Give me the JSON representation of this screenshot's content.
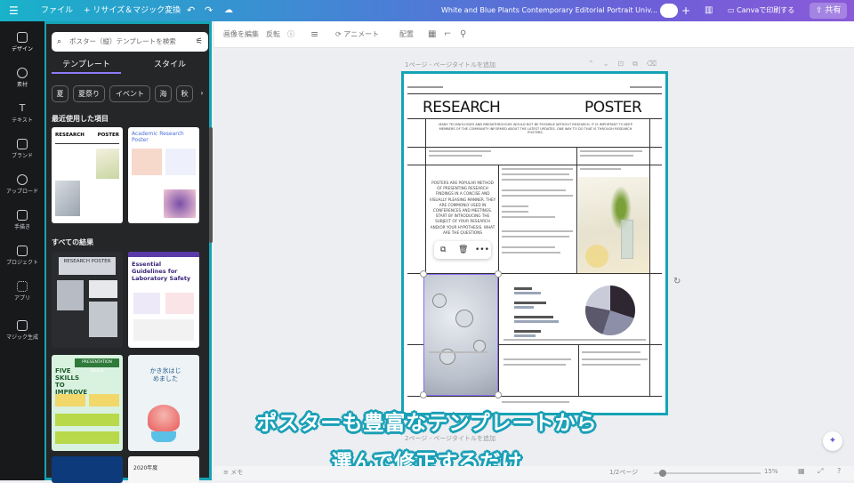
{
  "topbar": {
    "menu_icon": "hamburger-icon",
    "file": "ファイル",
    "resize": "+ リサイズ＆マジック変換",
    "undo_icon": "undo-icon",
    "redo_icon": "redo-icon",
    "cloud_icon": "cloud-icon",
    "doc_title": "White and Blue Plants Contemporary Editorial Portrait Univ...",
    "add_icon": "plus-icon",
    "chart_icon": "analytics-icon",
    "print_label": "Canvaで印刷する",
    "share_label": "共有"
  },
  "rail": {
    "items": [
      {
        "label": "デザイン",
        "icon": "design-icon"
      },
      {
        "label": "素材",
        "icon": "elements-icon"
      },
      {
        "label": "テキスト",
        "icon": "text-icon"
      },
      {
        "label": "ブランド",
        "icon": "brand-icon"
      },
      {
        "label": "アップロード",
        "icon": "upload-icon"
      },
      {
        "label": "手描き",
        "icon": "draw-icon"
      },
      {
        "label": "プロジェクト",
        "icon": "folder-icon"
      },
      {
        "label": "アプリ",
        "icon": "apps-icon"
      },
      {
        "label": "マジック生成",
        "icon": "magic-icon"
      }
    ]
  },
  "panel": {
    "search_placeholder": "ポスター（縦）テンプレートを検索",
    "tabs": [
      "テンプレート",
      "スタイル"
    ],
    "chips": [
      "夏",
      "夏祭り",
      "イベント",
      "海",
      "秋"
    ],
    "recent_title": "最近使用した項目",
    "all_results_title": "すべての結果",
    "recent_thumbs": [
      {
        "title_left": "RESEARCH",
        "title_right": "POSTER"
      },
      {
        "title": "Academic Research Poster"
      }
    ],
    "result_thumbs": [
      {
        "title": "RESEARCH POSTER"
      },
      {
        "title": "Essential Guidelines for Laboratory Safety"
      },
      {
        "title": "FIVE SKILLS TO IMPROVE YOUR",
        "badge": "PRESENTATION SKILLS"
      },
      {
        "title": "かき氷はじめました"
      },
      {
        "title": ""
      },
      {
        "title": "2020年度"
      }
    ]
  },
  "toolbar": {
    "edit_image": "画像を編集",
    "flip": "反転",
    "animate": "アニメート",
    "position": "配置"
  },
  "canvas": {
    "page_label": "1ページ - ページタイトルを追加",
    "page2_label": "2ページ - ページタイトルを追加"
  },
  "poster": {
    "title_left": "RESEARCH",
    "title_right": "POSTER",
    "intro": "MANY TECHNOLOGIES AND BREAKTHROUGHS WOULD NOT BE POSSIBLE WITHOUT RESEARCH. IT IS IMPORTANT TO KEEP MEMBERS OF THE COMMUNITY INFORMED ABOUT THE LATEST UPDATES. ONE WAY TO DO THAT IS THROUGH RESEARCH POSTERS.",
    "left_body": "POSTERS ARE POPULAR METHOD OF PRESENTING RESEARCH FINDINGS IN A CONCISE AND VISUALLY PLEASING MANNER. THEY ARE COMMONLY USED IN CONFERENCES AND MEETINGS. START BY INTRODUCING THE SUBJECT OF YOUR RESEARCH AND/OR YOUR HYPOTHESIS. WHAT ARE THE QUESTIONS"
  },
  "captions": {
    "line1": "ポスターも豊富なテンプレートから",
    "line2": "選んで修正するだけ"
  },
  "bottombar": {
    "notes": "メモ",
    "pages": "1/2ページ",
    "zoom": "15%"
  }
}
